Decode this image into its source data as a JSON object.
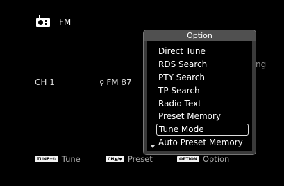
{
  "source": {
    "icon": "radio-tuner-icon",
    "label": "FM"
  },
  "channel": {
    "label": "CH 1"
  },
  "frequency": {
    "icon": "location-pin-icon",
    "text": "FM 87"
  },
  "background_peek_text": "ng",
  "guide": [
    {
      "key": "TUNE+/-",
      "label": "Tune"
    },
    {
      "key": "CH▲/▼",
      "label": "Preset"
    },
    {
      "key": "OPTION",
      "label": "Option"
    }
  ],
  "option_menu": {
    "title": "Option",
    "items": [
      "Direct Tune",
      "RDS Search",
      "PTY Search",
      "TP Search",
      "Radio Text",
      "Preset Memory",
      "Tune Mode",
      "Auto Preset Memory"
    ],
    "selected_index": 6,
    "more_below_icon": "scroll-down-arrow-icon"
  }
}
